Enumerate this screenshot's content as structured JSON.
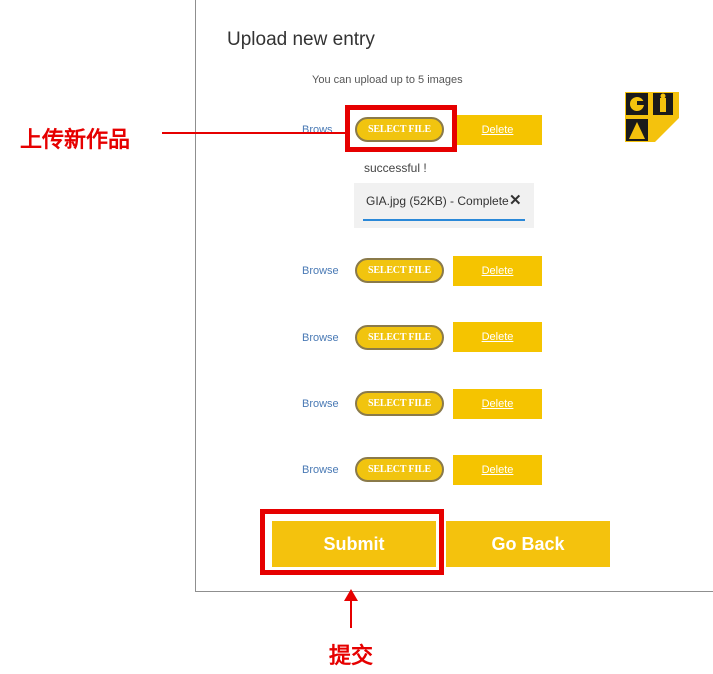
{
  "dialog": {
    "title": "Upload new entry",
    "hint": "You can upload up to 5 images"
  },
  "rows": [
    {
      "browse": "Brows",
      "select": "SELECT FILE",
      "delete": "Delete"
    },
    {
      "browse": "Browse",
      "select": "SELECT FILE",
      "delete": "Delete"
    },
    {
      "browse": "Browse",
      "select": "SELECT FILE",
      "delete": "Delete"
    },
    {
      "browse": "Browse",
      "select": "SELECT FILE",
      "delete": "Delete"
    },
    {
      "browse": "Browse",
      "select": "SELECT FILE",
      "delete": "Delete"
    }
  ],
  "upload_status": {
    "message": "successful !",
    "file": "GIA.jpg (52KB) - Complete",
    "remove_icon": "close-icon"
  },
  "actions": {
    "submit": "Submit",
    "go_back": "Go Back"
  },
  "annotations": {
    "upload_new_work": "上传新作品",
    "submit": "提交"
  },
  "colors": {
    "accent": "#f4c20d",
    "annotation": "#e60000",
    "link": "#4a7ab5",
    "progress": "#2a88d8"
  },
  "logo": {
    "icon": "gia-logo-icon"
  }
}
